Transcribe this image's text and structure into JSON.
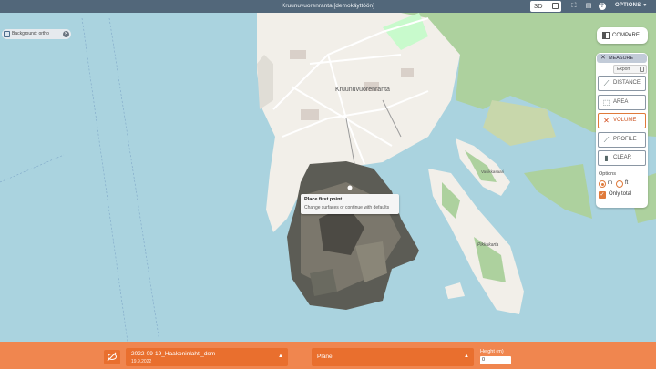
{
  "app": {
    "title": "Kruunuvuorenranta [demokäyttöön]",
    "view_3d_label": "3D",
    "options_label": "OPTIONS"
  },
  "background_chip": {
    "label": "Background: ortho"
  },
  "map_labels": {
    "district": "Kruunuvuorenranta",
    "island_small": "Vasikkasaari",
    "island_large": "Pikkukarta"
  },
  "panel": {
    "compare_label": "COMPARE",
    "measure_label": "MEASURE",
    "export_label": "Export",
    "tools": [
      {
        "label": "DISTANCE",
        "icon": "distance-icon",
        "active": false
      },
      {
        "label": "AREA",
        "icon": "area-icon",
        "active": false
      },
      {
        "label": "VOLUME",
        "icon": "volume-icon",
        "active": true
      },
      {
        "label": "PROFILE",
        "icon": "profile-icon",
        "active": false
      },
      {
        "label": "CLEAR",
        "icon": "trash-icon",
        "active": false
      }
    ],
    "options_label": "Options",
    "unit_m": "m",
    "unit_ft": "ft",
    "selected_unit": "m",
    "only_total_label": "Only total",
    "only_total_checked": true
  },
  "tooltip": {
    "title": "Place first point",
    "hint": "Change surfaces or continue with defaults"
  },
  "bottom": {
    "dataset_name": "2022-09-19_Haakoninlahti_dsm",
    "dataset_date": "19.9.2022",
    "surface": "Plane",
    "height_label": "Height (m)",
    "height_value": "0"
  },
  "colors": {
    "water": "#aad3df",
    "land": "#f2efe9",
    "forest": "#add19e",
    "accent": "#e96f2e",
    "bottom_bar": "#f0864f",
    "top_bar": "#46586c"
  }
}
